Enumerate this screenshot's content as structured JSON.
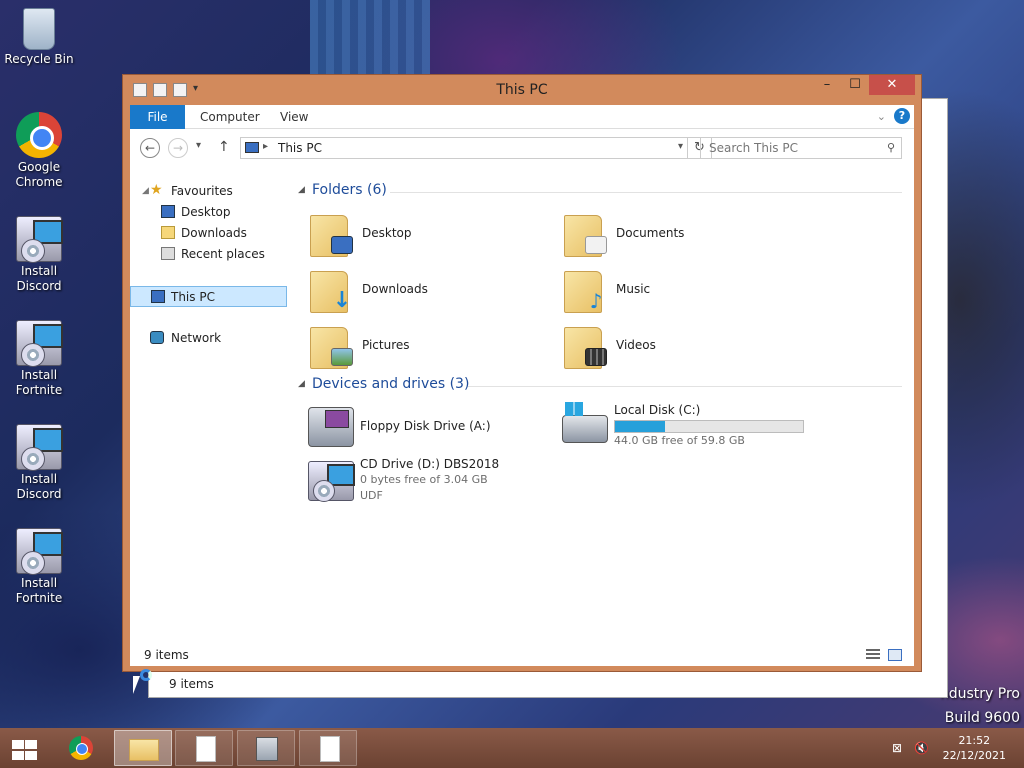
{
  "desktop": {
    "icons": [
      {
        "label": "Recycle Bin",
        "icon": "recycle-bin-icon"
      },
      {
        "label": "Google Chrome",
        "icon": "chrome-icon"
      },
      {
        "label": "Install Discord",
        "icon": "installer-icon"
      },
      {
        "label": "Install Fortnite",
        "icon": "installer-icon"
      },
      {
        "label": "Install Discord",
        "icon": "installer-icon"
      },
      {
        "label": "Install Fortnite",
        "icon": "installer-icon"
      }
    ],
    "watermark": {
      "line1": "ndustry Pro",
      "line2": "Build 9600"
    }
  },
  "background_window": {
    "status": "9 items"
  },
  "window": {
    "title": "This PC",
    "controls": {
      "minimize": "–",
      "maximize": "☐",
      "close": "✕"
    },
    "ribbon": {
      "tabs": [
        "File",
        "Computer",
        "View"
      ],
      "active_tab": "File"
    },
    "address": {
      "path": "This PC"
    },
    "search": {
      "placeholder": "Search This PC"
    },
    "nav": {
      "favourites_label": "Favourites",
      "favourites": [
        {
          "label": "Desktop"
        },
        {
          "label": "Downloads"
        },
        {
          "label": "Recent places"
        }
      ],
      "this_pc": "This PC",
      "network": "Network"
    },
    "folders": {
      "header": "Folders (6)",
      "items": [
        {
          "label": "Desktop"
        },
        {
          "label": "Documents"
        },
        {
          "label": "Downloads"
        },
        {
          "label": "Music"
        },
        {
          "label": "Pictures"
        },
        {
          "label": "Videos"
        }
      ]
    },
    "drives": {
      "header": "Devices and drives (3)",
      "floppy": {
        "name": "Floppy Disk Drive (A:)"
      },
      "local": {
        "name": "Local Disk (C:)",
        "free": "44.0 GB free of 59.8 GB",
        "used_fraction": 0.264
      },
      "cd": {
        "name": "CD Drive (D:) DBS2018",
        "free": "0 bytes free of 3.04 GB",
        "fs": "UDF"
      }
    },
    "status": "9 items"
  },
  "taskbar": {
    "clock_time": "21:52",
    "clock_date": "22/12/2021"
  },
  "colors": {
    "accent": "#1979ca",
    "window_frame": "#d28a5c",
    "drive_bar": "#26a0da"
  }
}
